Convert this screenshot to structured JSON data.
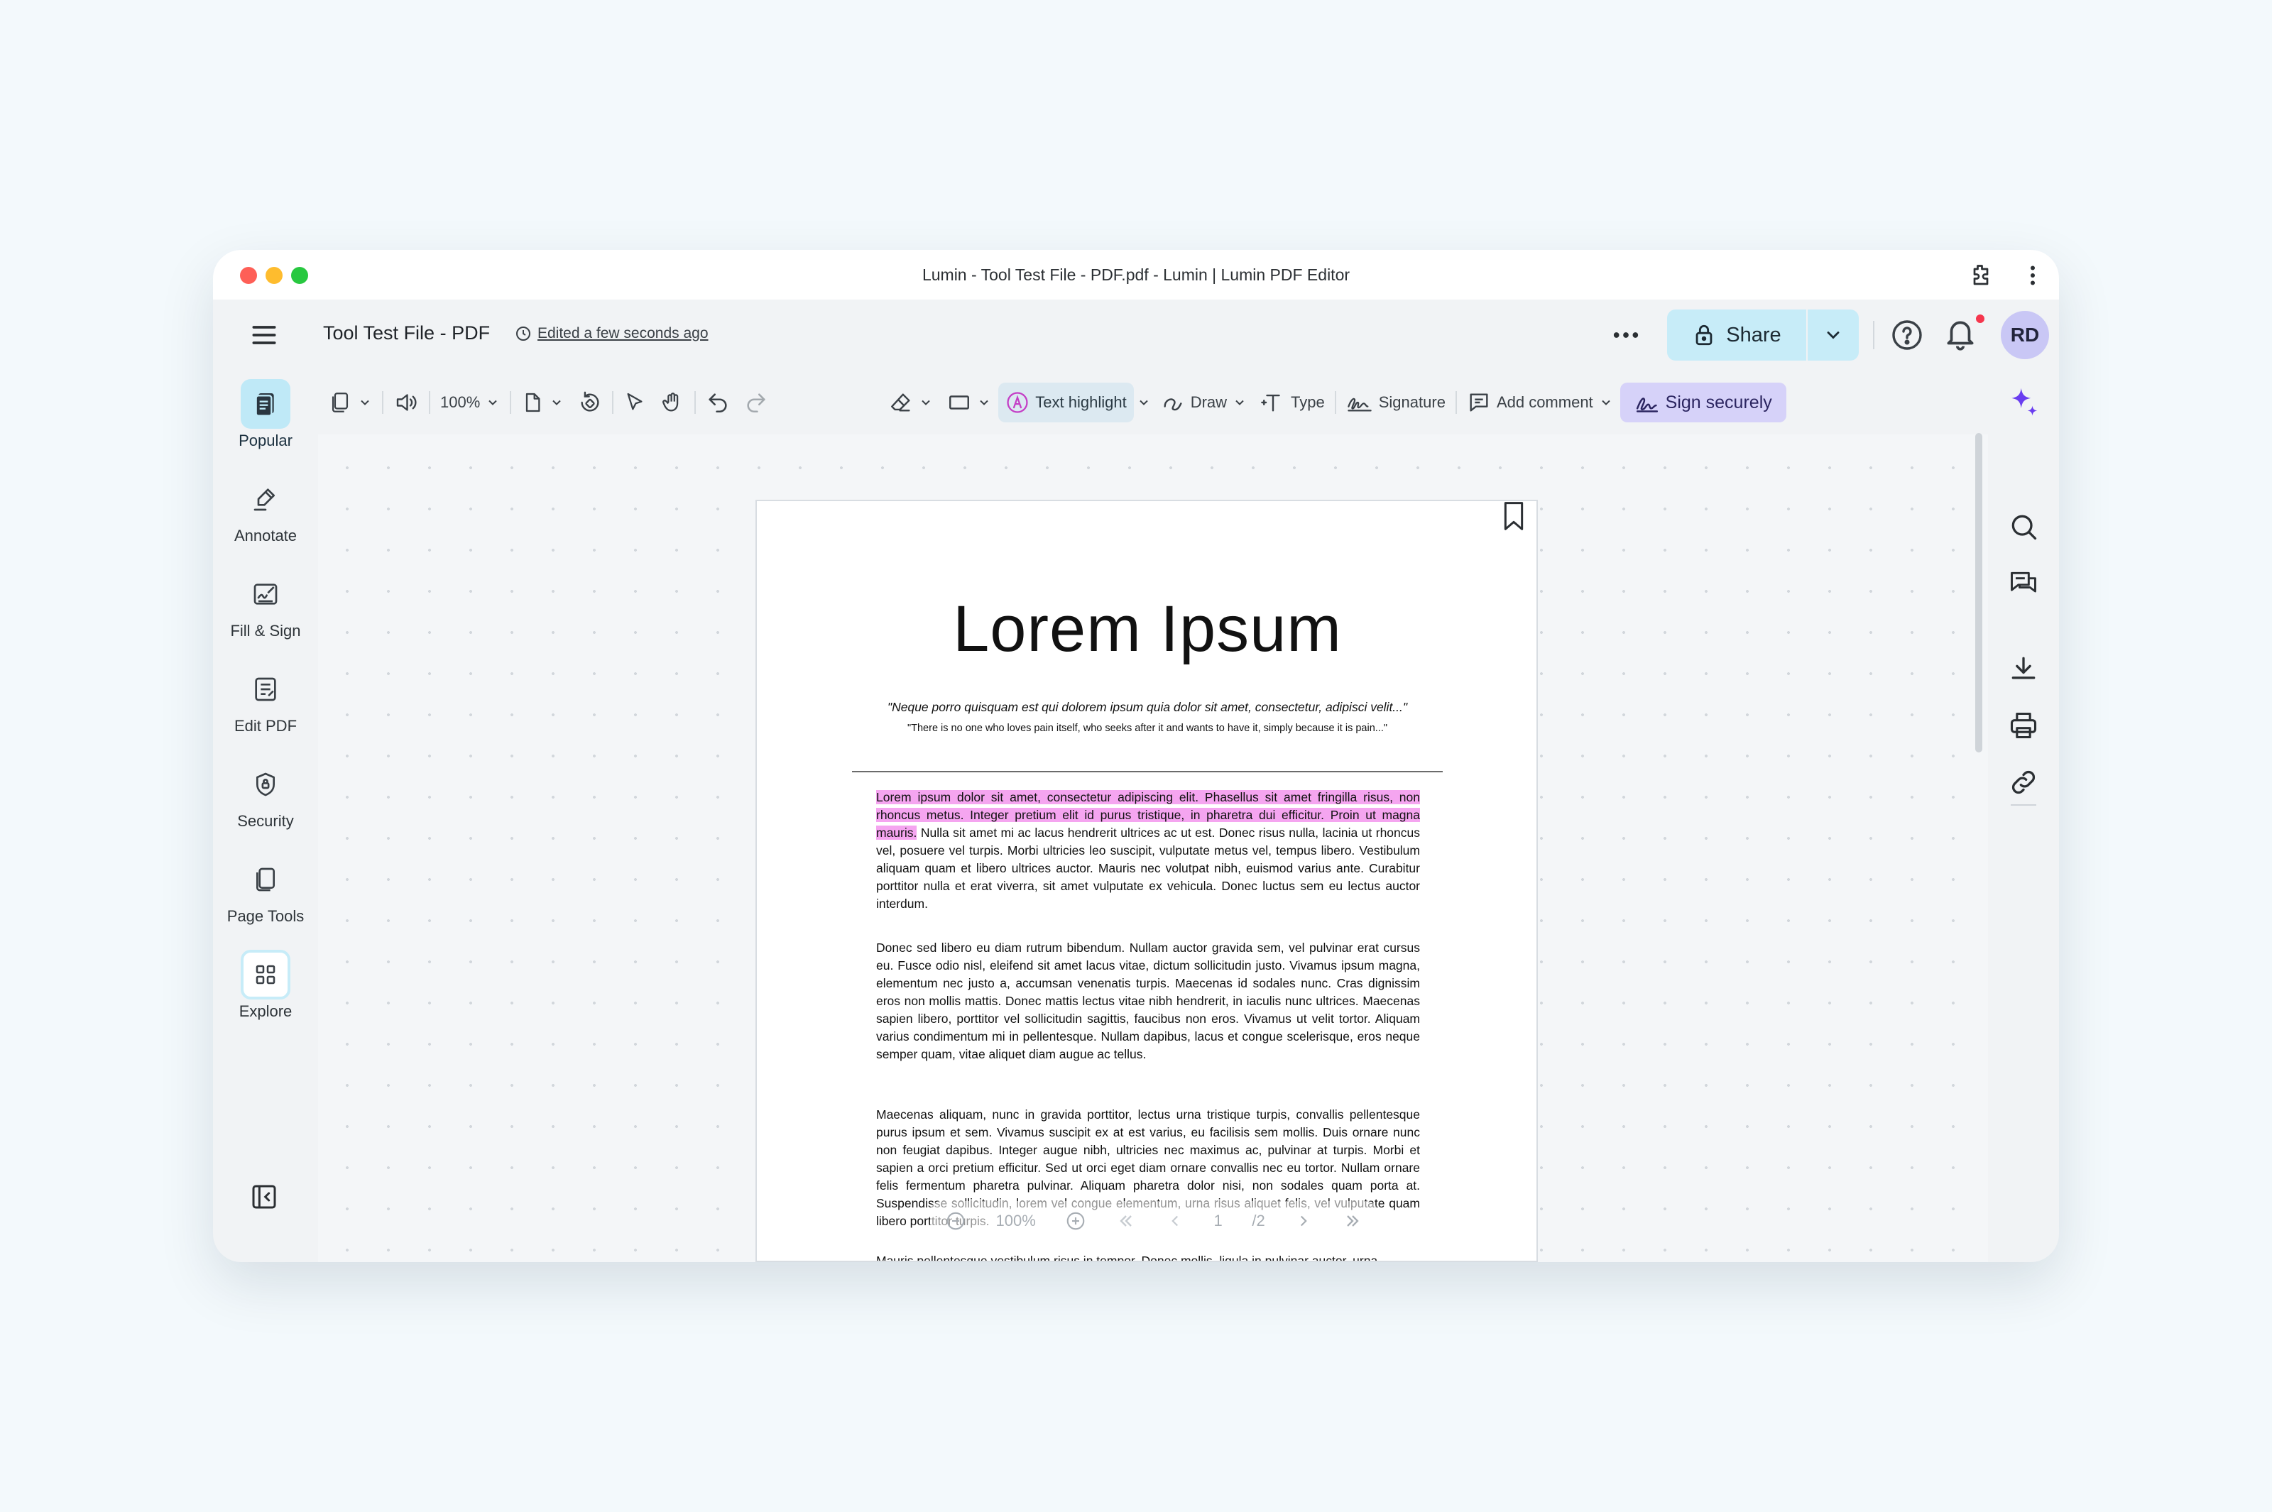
{
  "window": {
    "title": "Lumin - Tool Test File - PDF.pdf - Lumin | Lumin PDF Editor"
  },
  "header": {
    "doc_title": "Tool Test File - PDF",
    "edited_status": "Edited a few seconds ago",
    "share_label": "Share",
    "avatar_initials": "RD",
    "accent_color": "#c7ecf8",
    "notification_color": "#f5364d"
  },
  "sidebar": {
    "items": [
      {
        "label": "Popular",
        "icon": "popular-icon",
        "active": true
      },
      {
        "label": "Annotate",
        "icon": "annotate-icon"
      },
      {
        "label": "Fill & Sign",
        "icon": "fill-sign-icon"
      },
      {
        "label": "Edit PDF",
        "icon": "edit-pdf-icon"
      },
      {
        "label": "Security",
        "icon": "security-icon"
      },
      {
        "label": "Page Tools",
        "icon": "page-tools-icon"
      },
      {
        "label": "Explore",
        "icon": "explore-icon"
      }
    ]
  },
  "toolbar": {
    "zoom": "100%",
    "text_highlight": "Text highlight",
    "draw": "Draw",
    "type": "Type",
    "signature": "Signature",
    "add_comment": "Add comment",
    "sign_securely": "Sign securely",
    "sign_color": "#d6d2f9"
  },
  "document": {
    "title": "Lorem Ipsum",
    "quote1": "\"Neque porro quisquam est qui dolorem ipsum quia dolor sit amet, consectetur, adipisci velit...\"",
    "quote2": "\"There is no one who loves pain itself, who seeks after it and wants to have it, simply because it is pain...\"",
    "para1_highlighted": "Lorem ipsum dolor sit amet, consectetur adipiscing elit. Phasellus sit amet fringilla risus, non rhoncus metus. Integer pretium elit id purus tristique, in pharetra dui efficitur. Proin ut magna mauris.",
    "para1_rest": " Nulla sit amet mi ac lacus hendrerit ultrices ac ut est. Donec risus nulla, lacinia ut rhoncus vel, posuere vel turpis. Morbi ultricies leo suscipit, vulputate metus vel, tempus libero. Vestibulum aliquam quam et libero ultrices auctor. Mauris nec volutpat nibh, euismod varius ante. Curabitur porttitor nulla et erat viverra, sit amet vulputate ex vehicula. Donec luctus sem eu lectus auctor interdum.",
    "para2": "Donec sed libero eu diam rutrum bibendum. Nullam auctor gravida sem, vel pulvinar erat cursus eu. Fusce odio nisl, eleifend sit amet lacus vitae, dictum sollicitudin justo. Vivamus ipsum magna, elementum nec justo a, accumsan venenatis turpis. Maecenas id sodales nunc. Cras dignissim eros non mollis mattis. Donec mattis lectus vitae nibh hendrerit, in iaculis nunc ultrices. Maecenas sapien libero, porttitor vel sollicitudin sagittis, faucibus non eros. Vivamus ut velit tortor. Aliquam varius condimentum mi in pellentesque. Nullam dapibus, lacus et congue scelerisque, eros neque semper quam, vitae aliquet diam augue ac tellus.",
    "para3": "Maecenas aliquam, nunc in gravida porttitor, lectus urna tristique turpis, convallis pellentesque purus ipsum et sem. Vivamus suscipit ex at est varius, eu facilisis sem mollis. Duis ornare nunc non feugiat dapibus. Integer augue nibh, ultricies nec maximus ac, pulvinar at turpis. Morbi et sapien a orci pretium efficitur. Sed ut orci eget diam ornare convallis nec eu tortor. Nullam ornare felis fermentum pharetra pulvinar. Aliquam pharetra dolor nisi, non sodales quam porta at. Suspendisse sollicitudin, lorem vel congue elementum, urna risus aliquet felis, vel vulputate quam libero porttitor turpis.",
    "para4": "Mauris pellentesque vestibulum risus in tempor. Donec mollis, ligula in pulvinar auctor, urna",
    "highlight_color": "#f5a5f0"
  },
  "pager": {
    "zoom": "100%",
    "current_page": "1",
    "total_pages": "/2"
  }
}
